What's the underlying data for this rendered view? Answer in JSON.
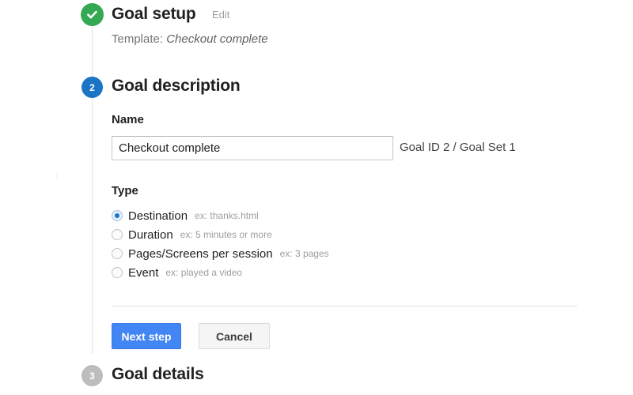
{
  "steps": [
    {
      "marker": "check-icon",
      "status": "complete",
      "title": "Goal setup",
      "edit_label": "Edit",
      "template_prefix": "Template:",
      "template_value": "Checkout complete"
    },
    {
      "marker": "2",
      "status": "active",
      "title": "Goal description"
    },
    {
      "marker": "3",
      "status": "pending",
      "title": "Goal details"
    }
  ],
  "form": {
    "name_label": "Name",
    "name_value": "Checkout complete",
    "name_placeholder": "Goal name",
    "goal_id_text": "Goal ID 2 / Goal Set 1",
    "type_label": "Type",
    "type_options": [
      {
        "label": "Destination",
        "hint": "ex: thanks.html",
        "selected": true
      },
      {
        "label": "Duration",
        "hint": "ex: 5 minutes or more",
        "selected": false
      },
      {
        "label": "Pages/Screens per session",
        "hint": "ex: 3 pages",
        "selected": false
      },
      {
        "label": "Event",
        "hint": "ex: played a video",
        "selected": false
      }
    ]
  },
  "actions": {
    "next_label": "Next step",
    "cancel_label": "Cancel"
  },
  "colors": {
    "complete": "#34a853",
    "active": "#1b74c4",
    "pending": "#bdbdbd",
    "primary_button": "#4285f4"
  }
}
